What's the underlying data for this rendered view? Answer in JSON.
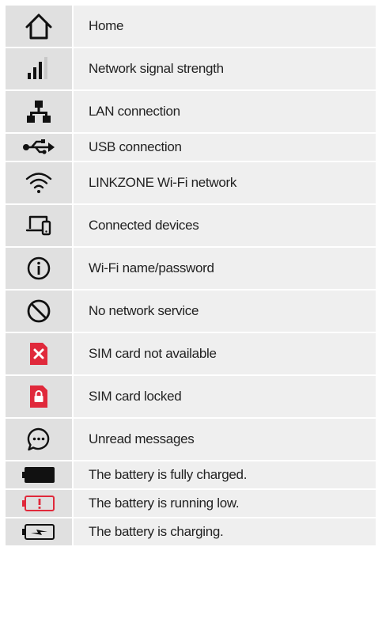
{
  "colors": {
    "icon_dark": "#111111",
    "alert_red": "#e0293b",
    "grey_bar": "#c8c8c8"
  },
  "rows": [
    {
      "icon": "home-icon",
      "label": "Home"
    },
    {
      "icon": "signal-strength-icon",
      "label": "Network signal strength"
    },
    {
      "icon": "lan-icon",
      "label": "LAN connection"
    },
    {
      "icon": "usb-icon",
      "label": "USB connection"
    },
    {
      "icon": "wifi-icon",
      "label": "LINKZONE Wi-Fi network"
    },
    {
      "icon": "connected-devices-icon",
      "label": "Connected devices"
    },
    {
      "icon": "info-icon",
      "label": "Wi-Fi name/password"
    },
    {
      "icon": "no-service-icon",
      "label": "No network service"
    },
    {
      "icon": "sim-unavailable-icon",
      "label": "SIM card not available"
    },
    {
      "icon": "sim-locked-icon",
      "label": "SIM card locked"
    },
    {
      "icon": "message-icon",
      "label": "Unread messages"
    },
    {
      "icon": "battery-full-icon",
      "label": "The battery is fully charged."
    },
    {
      "icon": "battery-low-icon",
      "label": "The battery is running low."
    },
    {
      "icon": "battery-charging-icon",
      "label": "The battery is charging."
    }
  ]
}
